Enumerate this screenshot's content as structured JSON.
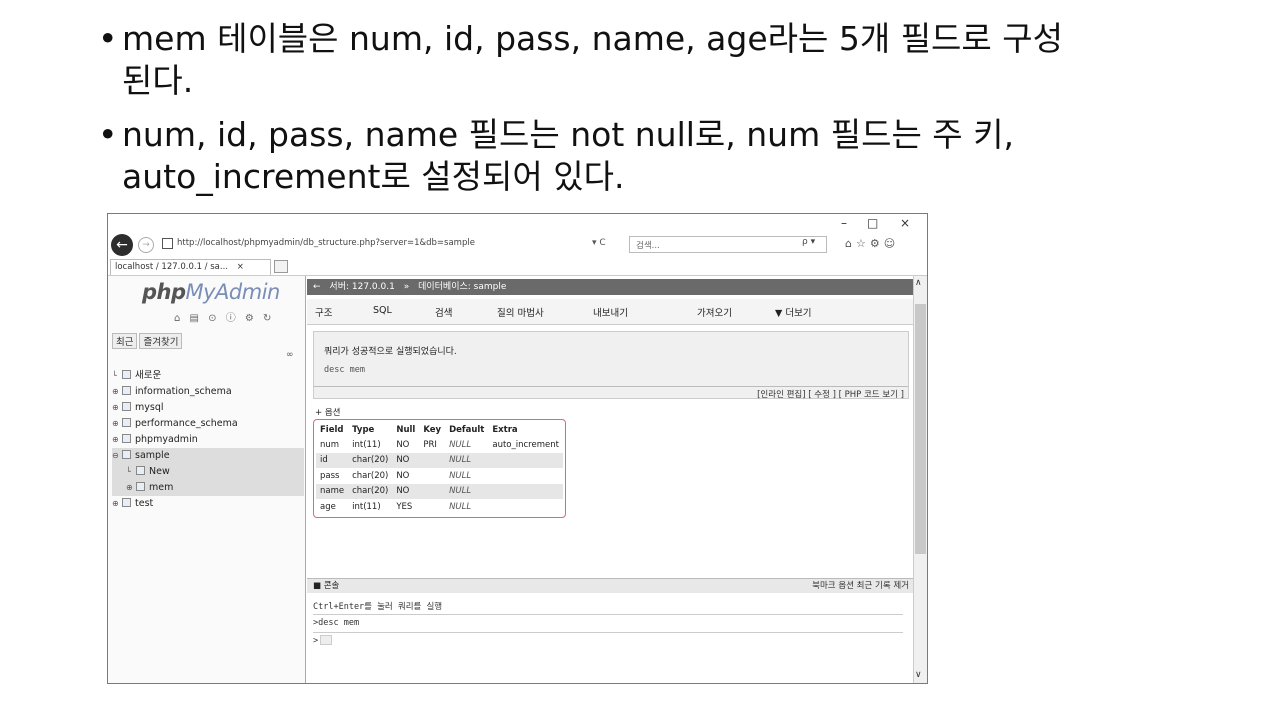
{
  "bullets": [
    "mem 테이블은 num, id, pass, name, age라는 5개 필드로 구성\n된다.",
    "num, id, pass, name 필드는 not null로, num 필드는 주 키,\nauto_increment로 설정되어 있다."
  ],
  "bullet_char": "•",
  "browser": {
    "url": "http://localhost/phpmyadmin/db_structure.php?server=1&db=sample",
    "url_controls": "▾ C",
    "search_placeholder": "검색...",
    "search_controls": "ρ ▾",
    "toolbar_icons": "⌂☆⚙☺",
    "tab_title": "localhost / 127.0.0.1 / sa...",
    "tab_close": "×",
    "window_controls": {
      "minimize": "–",
      "maximize": "□",
      "close": "×"
    },
    "back": "←",
    "forward": "→"
  },
  "left": {
    "logo_main": "php",
    "logo_accent": "MyAdmin",
    "icons": "⌂ ▤ ⊙ ⓘ ⚙ ↻",
    "nav": [
      "최근",
      "즐겨찾기"
    ],
    "link_icon": "∞",
    "tree": [
      {
        "expander": "",
        "label": "새로운",
        "selected": false
      },
      {
        "expander": "⊕",
        "label": "information_schema",
        "selected": false
      },
      {
        "expander": "⊕",
        "label": "mysql",
        "selected": false
      },
      {
        "expander": "⊕",
        "label": "performance_schema",
        "selected": false
      },
      {
        "expander": "⊕",
        "label": "phpmyadmin",
        "selected": false
      },
      {
        "expander": "⊖",
        "label": "sample",
        "selected": true
      },
      {
        "expander": "",
        "label": "New",
        "selected": true
      },
      {
        "expander": "⊕",
        "label": "mem",
        "selected": true
      },
      {
        "expander": "⊕",
        "label": "test",
        "selected": false
      }
    ]
  },
  "right": {
    "server_label": "서버: 127.0.0.1",
    "db_label": "데이터베이스: sample",
    "menu": [
      "구조",
      "SQL",
      "검색",
      "질의 마법사",
      "내보내기",
      "가져오기",
      "▼ 더보기"
    ],
    "success_msg": "쿼리가 성공적으로 실행되었습니다.",
    "query": "desc mem",
    "sql_links": "[인라인 편집] [ 수정 ] [ PHP 코드 보기 ]",
    "options": "+ 옵션",
    "table": {
      "headers": [
        "Field",
        "Type",
        "Null",
        "Key",
        "Default",
        "Extra"
      ],
      "rows": [
        [
          "num",
          "int(11)",
          "NO",
          "PRI",
          "NULL",
          "auto_increment"
        ],
        [
          "id",
          "char(20)",
          "NO",
          "",
          "NULL",
          ""
        ],
        [
          "pass",
          "char(20)",
          "NO",
          "",
          "NULL",
          ""
        ],
        [
          "name",
          "char(20)",
          "NO",
          "",
          "NULL",
          ""
        ],
        [
          "age",
          "int(11)",
          "YES",
          "",
          "NULL",
          ""
        ]
      ]
    },
    "console": {
      "title": "콘솔",
      "actions": "북마크  옵션  최근 기록  제거",
      "hint": "Ctrl+Enter를 눌러 쿼리를 실행",
      "history": ">desc mem",
      "prompt": ">"
    }
  }
}
